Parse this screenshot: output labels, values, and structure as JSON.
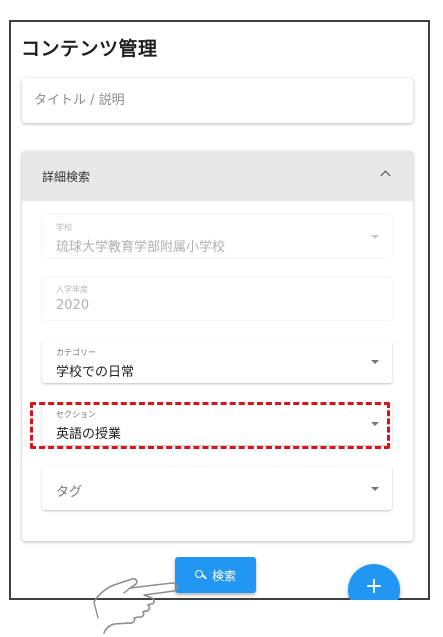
{
  "page": {
    "title": "コンテンツ管理"
  },
  "search": {
    "placeholder": "タイトル / 説明"
  },
  "detail_panel": {
    "title": "詳細検索",
    "expanded": true
  },
  "fields": {
    "school": {
      "label": "学校",
      "value": "琉球大学教育学部附属小学校",
      "disabled": true
    },
    "enrollment_year": {
      "label": "入学年度",
      "value": "2020",
      "disabled": true
    },
    "category": {
      "label": "カテゴリー",
      "value": "学校での日常"
    },
    "section": {
      "label": "セクション",
      "value": "英語の授業",
      "highlighted": true
    },
    "tag": {
      "placeholder": "タグ"
    }
  },
  "buttons": {
    "search_label": "検索",
    "fab_label": "+"
  },
  "icons": {
    "search": "magnifier-icon",
    "collapse": "chevron-up-icon",
    "dropdown": "caret-down-icon",
    "pointer": "pointing-hand-icon"
  },
  "colors": {
    "primary": "#2196f3",
    "highlight": "#d8141a",
    "panel_header": "#e8e8e8"
  }
}
